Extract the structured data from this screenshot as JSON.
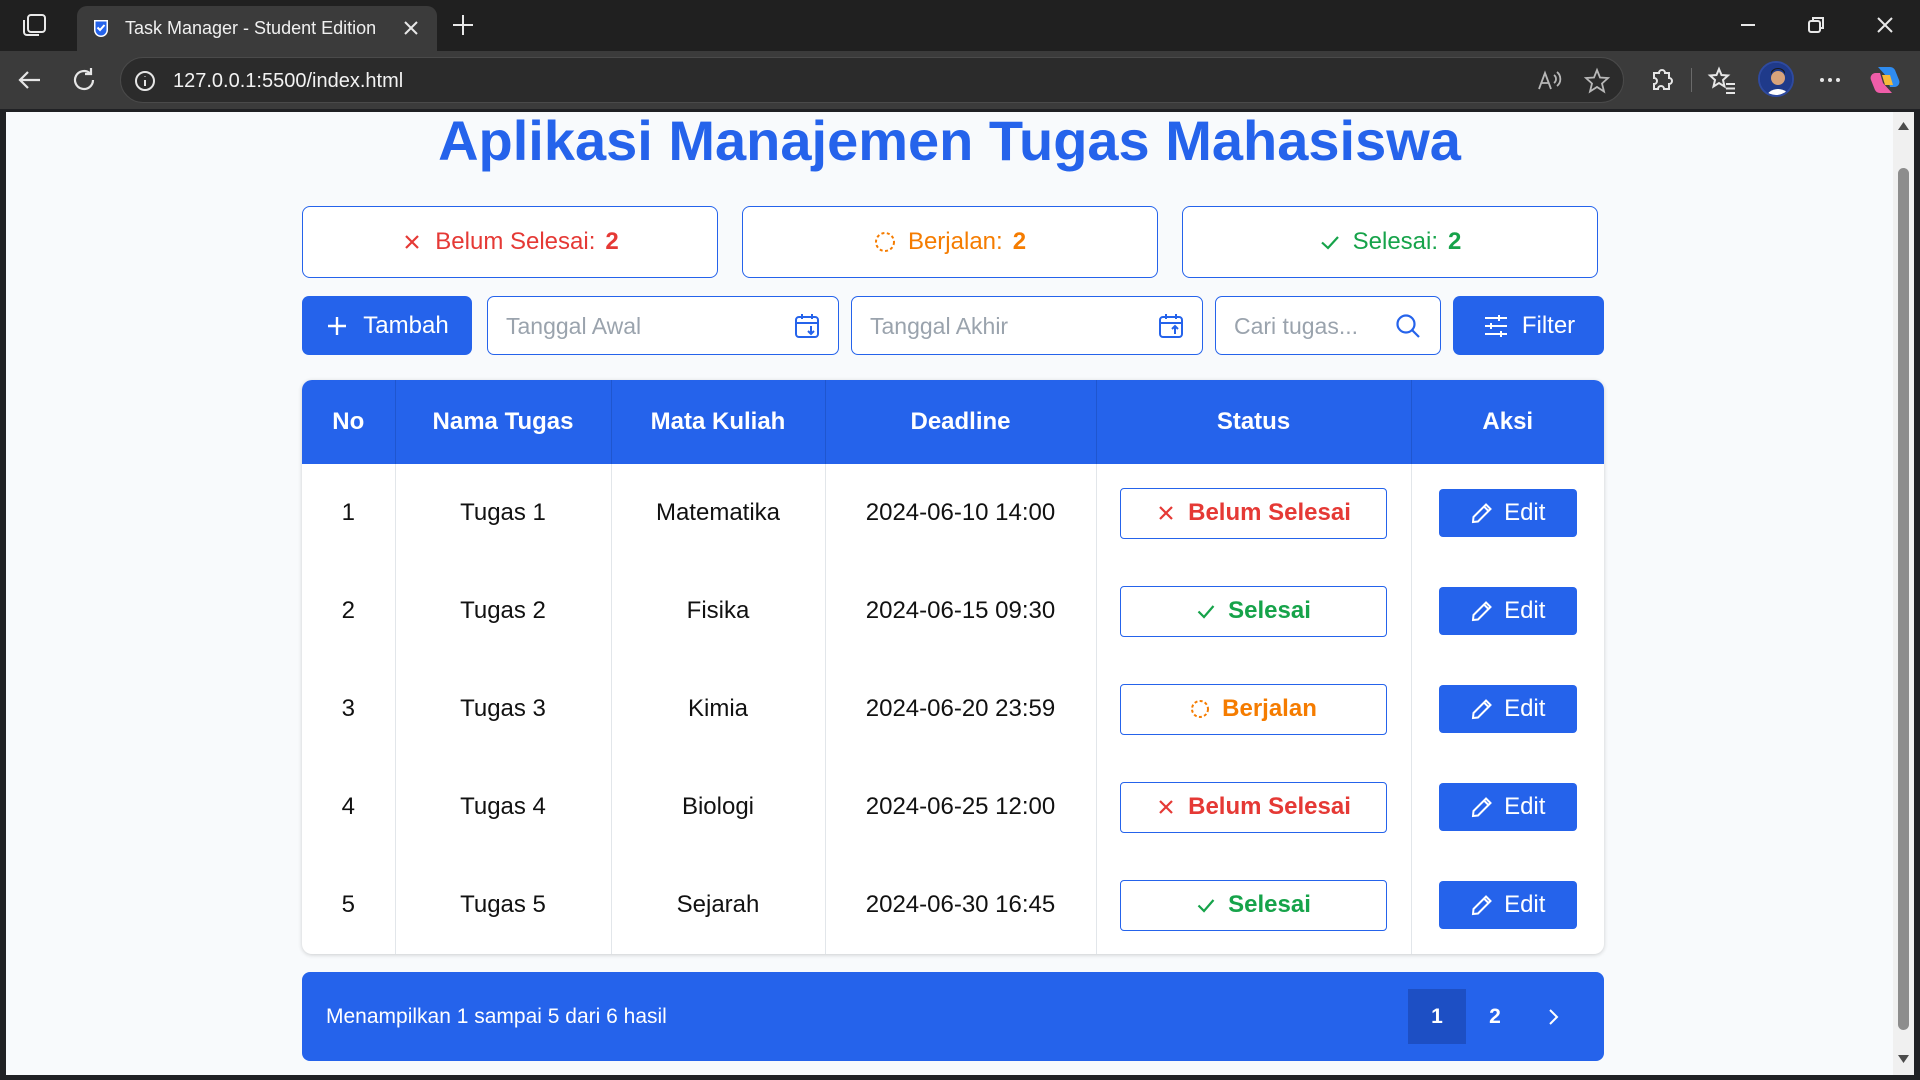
{
  "browser": {
    "tab_title": "Task Manager - Student Edition",
    "url": "127.0.0.1:5500/index.html"
  },
  "page": {
    "title": "Aplikasi Manajemen Tugas Mahasiswa"
  },
  "stats": [
    {
      "label": "Belum Selesai:",
      "count": "2",
      "color": "#e53935",
      "icon": "x-icon"
    },
    {
      "label": "Berjalan:",
      "count": "2",
      "color": "#f57c00",
      "icon": "spinner-icon"
    },
    {
      "label": "Selesai:",
      "count": "2",
      "color": "#16a34a",
      "icon": "check-icon"
    }
  ],
  "controls": {
    "add_label": "Tambah",
    "start_date_placeholder": "Tanggal Awal",
    "end_date_placeholder": "Tanggal Akhir",
    "search_placeholder": "Cari tugas...",
    "filter_label": "Filter"
  },
  "table": {
    "headers": [
      "No",
      "Nama Tugas",
      "Mata Kuliah",
      "Deadline",
      "Status",
      "Aksi"
    ],
    "rows": [
      {
        "no": "1",
        "name": "Tugas 1",
        "course": "Matematika",
        "deadline": "2024-06-10 14:00",
        "status": "Belum Selesai",
        "status_kind": "pending",
        "action": "Edit"
      },
      {
        "no": "2",
        "name": "Tugas 2",
        "course": "Fisika",
        "deadline": "2024-06-15 09:30",
        "status": "Selesai",
        "status_kind": "done",
        "action": "Edit"
      },
      {
        "no": "3",
        "name": "Tugas 3",
        "course": "Kimia",
        "deadline": "2024-06-20 23:59",
        "status": "Berjalan",
        "status_kind": "progress",
        "action": "Edit"
      },
      {
        "no": "4",
        "name": "Tugas 4",
        "course": "Biologi",
        "deadline": "2024-06-25 12:00",
        "status": "Belum Selesai",
        "status_kind": "pending",
        "action": "Edit"
      },
      {
        "no": "5",
        "name": "Tugas 5",
        "course": "Sejarah",
        "deadline": "2024-06-30 16:45",
        "status": "Selesai",
        "status_kind": "done",
        "action": "Edit"
      }
    ]
  },
  "pagination": {
    "summary": "Menampilkan 1 sampai 5 dari 6 hasil",
    "pages": [
      "1",
      "2"
    ],
    "current": "1"
  },
  "colors": {
    "primary": "#2563eb",
    "pending": "#e53935",
    "progress": "#f57c00",
    "done": "#16a34a"
  }
}
